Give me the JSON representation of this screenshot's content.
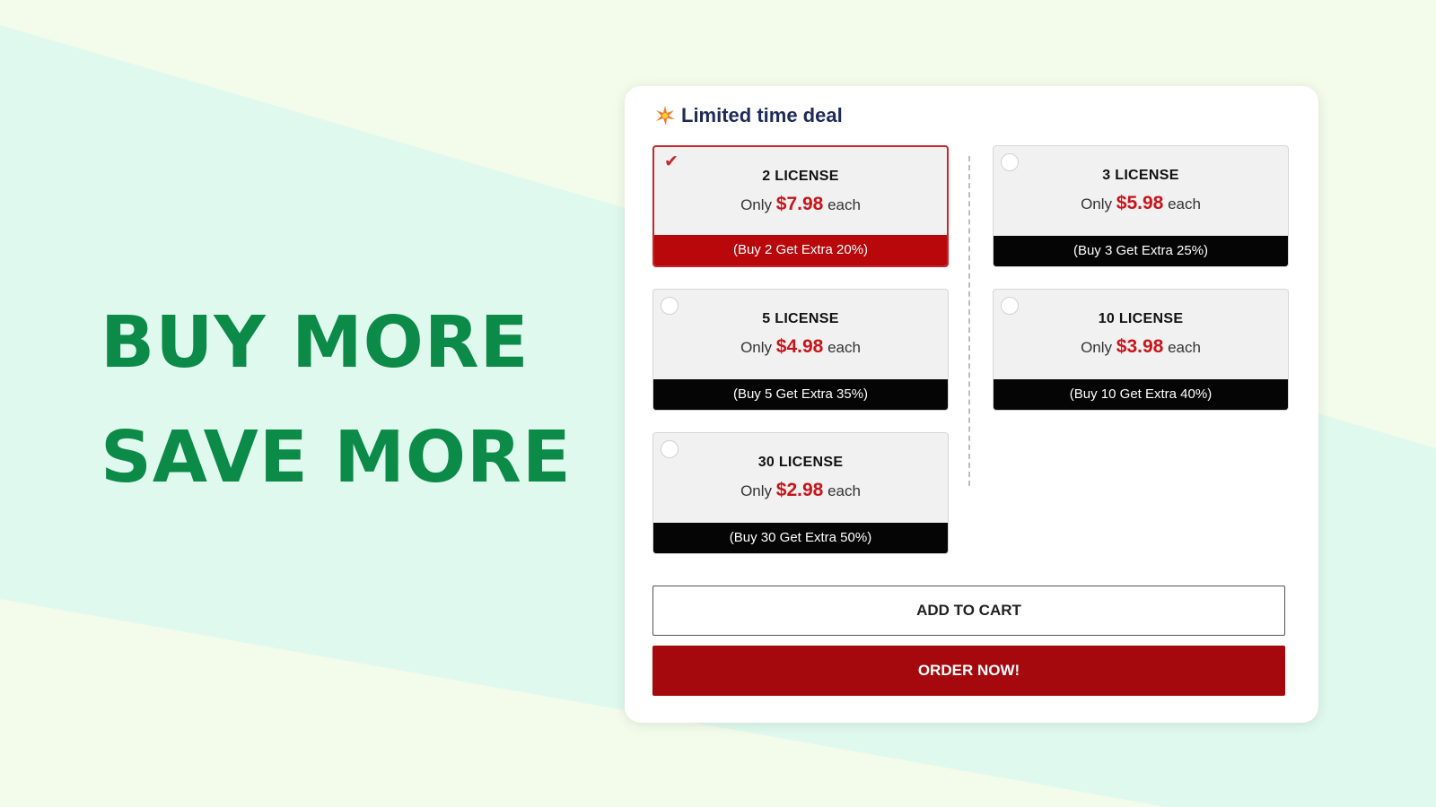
{
  "headline": {
    "line1": "BUY MORE",
    "line2": "SAVE MORE"
  },
  "deal": {
    "title": "Limited time deal",
    "icon": "sparkle-icon"
  },
  "options": [
    {
      "title": "2 LICENSE",
      "prefix": "Only",
      "price": "$7.98",
      "suffix": "each",
      "banner": "(Buy 2 Get Extra 20%)",
      "selected": true
    },
    {
      "title": "3 LICENSE",
      "prefix": "Only",
      "price": "$5.98",
      "suffix": "each",
      "banner": "(Buy 3 Get Extra 25%)",
      "selected": false
    },
    {
      "title": "5 LICENSE",
      "prefix": "Only",
      "price": "$4.98",
      "suffix": "each",
      "banner": "(Buy 5 Get Extra 35%)",
      "selected": false
    },
    {
      "title": "10 LICENSE",
      "prefix": "Only",
      "price": "$3.98",
      "suffix": "each",
      "banner": "(Buy 10 Get Extra 40%)",
      "selected": false
    },
    {
      "title": "30 LICENSE",
      "prefix": "Only",
      "price": "$2.98",
      "suffix": "each",
      "banner": "(Buy 30 Get Extra 50%)",
      "selected": false
    }
  ],
  "buttons": {
    "add_to_cart": "ADD TO CART",
    "order_now": "ORDER NOW!"
  },
  "colors": {
    "headline": "#0b8a48",
    "accent_red": "#c9141a",
    "order_button": "#a5090d",
    "banner_black": "#050505",
    "background": "#f3fbea",
    "background_band": "#e0f9ee"
  }
}
